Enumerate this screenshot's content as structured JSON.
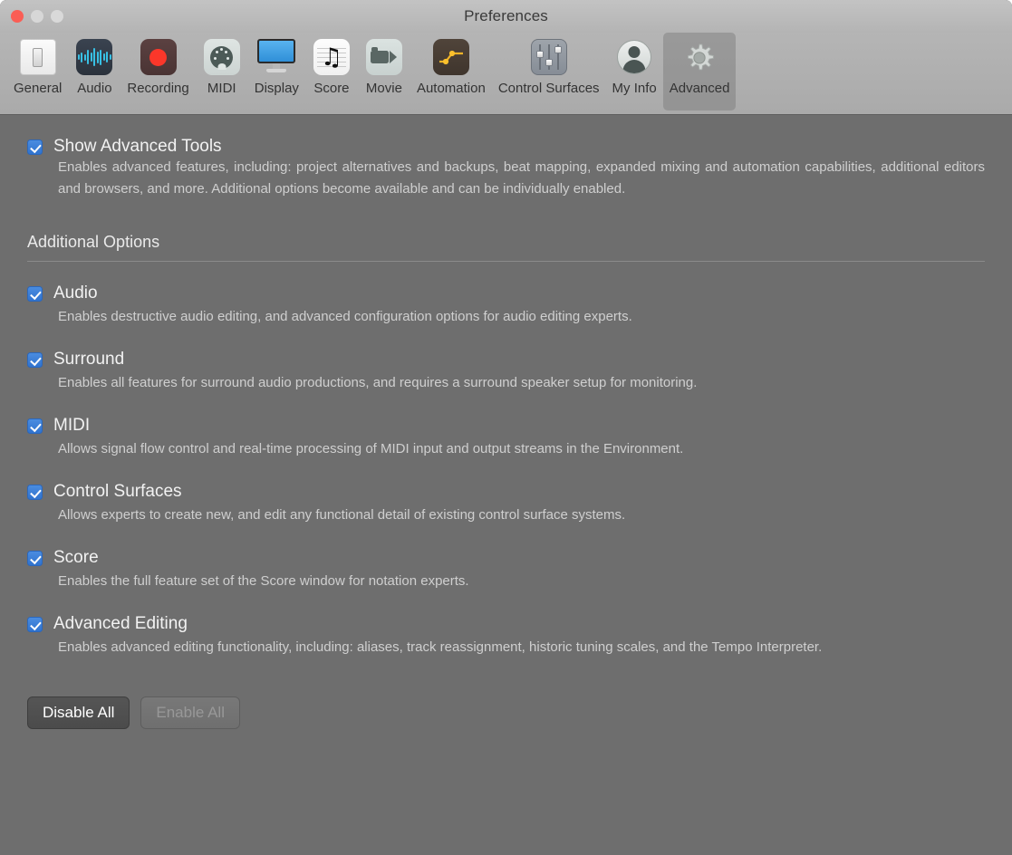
{
  "window": {
    "title": "Preferences",
    "traffic_lights": [
      {
        "name": "close",
        "color": "#fa5e55"
      },
      {
        "name": "minimize",
        "color": "#d7d7d7"
      },
      {
        "name": "zoom",
        "color": "#d9d9d9"
      }
    ]
  },
  "toolbar": {
    "selected": "Advanced",
    "items": [
      {
        "label": "General",
        "icon": "light-switch-icon"
      },
      {
        "label": "Audio",
        "icon": "waveform-icon"
      },
      {
        "label": "Recording",
        "icon": "record-dot-icon"
      },
      {
        "label": "MIDI",
        "icon": "midi-din-connector-icon"
      },
      {
        "label": "Display",
        "icon": "monitor-icon"
      },
      {
        "label": "Score",
        "icon": "music-note-staff-icon"
      },
      {
        "label": "Movie",
        "icon": "video-camera-icon"
      },
      {
        "label": "Automation",
        "icon": "automation-curve-icon"
      },
      {
        "label": "Control Surfaces",
        "icon": "faders-icon"
      },
      {
        "label": "My Info",
        "icon": "user-avatar-icon"
      },
      {
        "label": "Advanced",
        "icon": "gear-icon"
      }
    ]
  },
  "main": {
    "show_advanced_tools": {
      "label": "Show Advanced Tools",
      "checked": true,
      "description": "Enables advanced features, including: project alternatives and backups, beat mapping, expanded mixing and automation capabilities, additional editors and browsers, and more. Additional options become available and can be individually enabled."
    },
    "section_title": "Additional Options",
    "options": [
      {
        "label": "Audio",
        "checked": true,
        "description": "Enables destructive audio editing, and advanced configuration options for audio editing experts."
      },
      {
        "label": "Surround",
        "checked": true,
        "description": "Enables all features for surround audio productions, and requires a surround speaker setup for monitoring."
      },
      {
        "label": "MIDI",
        "checked": true,
        "description": "Allows signal flow control and real-time processing of MIDI input and output streams in the Environment."
      },
      {
        "label": "Control Surfaces",
        "checked": true,
        "description": "Allows experts to create new, and edit any functional detail of existing control surface systems."
      },
      {
        "label": "Score",
        "checked": true,
        "description": "Enables the full feature set of the Score window for notation experts."
      },
      {
        "label": "Advanced Editing",
        "checked": true,
        "description": "Enables advanced editing functionality, including: aliases, track reassignment, historic tuning scales, and the Tempo Interpreter."
      }
    ],
    "buttons": {
      "disable_all": "Disable All",
      "enable_all": "Enable All"
    }
  },
  "colors": {
    "titlebar": "#b4b4b4",
    "toolbar": "#ababab",
    "content_bg": "#6e6e6e",
    "checkbox_blue": "#3478dc",
    "title_text": "#3a3a3a",
    "body_text": "#f2f2f2",
    "desc_text": "#cfcfcf"
  }
}
